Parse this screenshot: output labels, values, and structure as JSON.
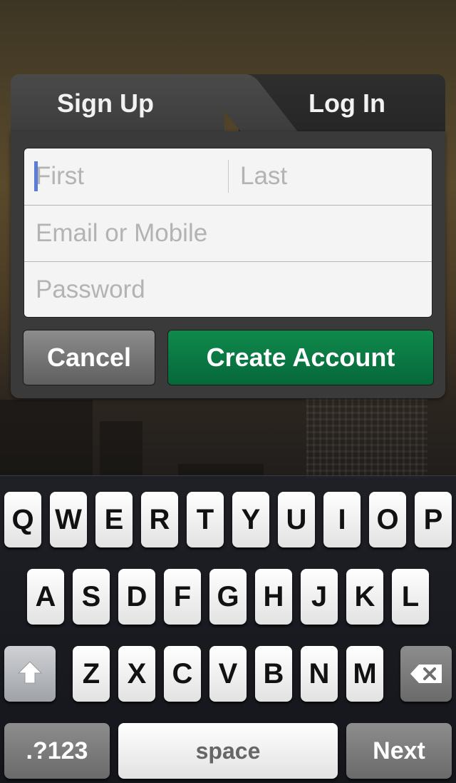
{
  "tabs": {
    "signup": "Sign Up",
    "login": "Log In"
  },
  "form": {
    "first_placeholder": "First",
    "last_placeholder": "Last",
    "email_placeholder": "Email or Mobile",
    "password_placeholder": "Password"
  },
  "buttons": {
    "cancel": "Cancel",
    "create": "Create Account"
  },
  "keyboard": {
    "row1": [
      "Q",
      "W",
      "E",
      "R",
      "T",
      "Y",
      "U",
      "I",
      "O",
      "P"
    ],
    "row2": [
      "A",
      "S",
      "D",
      "F",
      "G",
      "H",
      "J",
      "K",
      "L"
    ],
    "row3": [
      "Z",
      "X",
      "C",
      "V",
      "B",
      "N",
      "M"
    ],
    "numbers": ".?123",
    "space": "space",
    "next": "Next",
    "shift_icon": "shift-arrow-icon",
    "delete_icon": "backspace-icon"
  },
  "colors": {
    "create_green": "#0a7a43",
    "panel_dark": "#3a3a3a",
    "caret_blue": "#5a7bd6"
  }
}
